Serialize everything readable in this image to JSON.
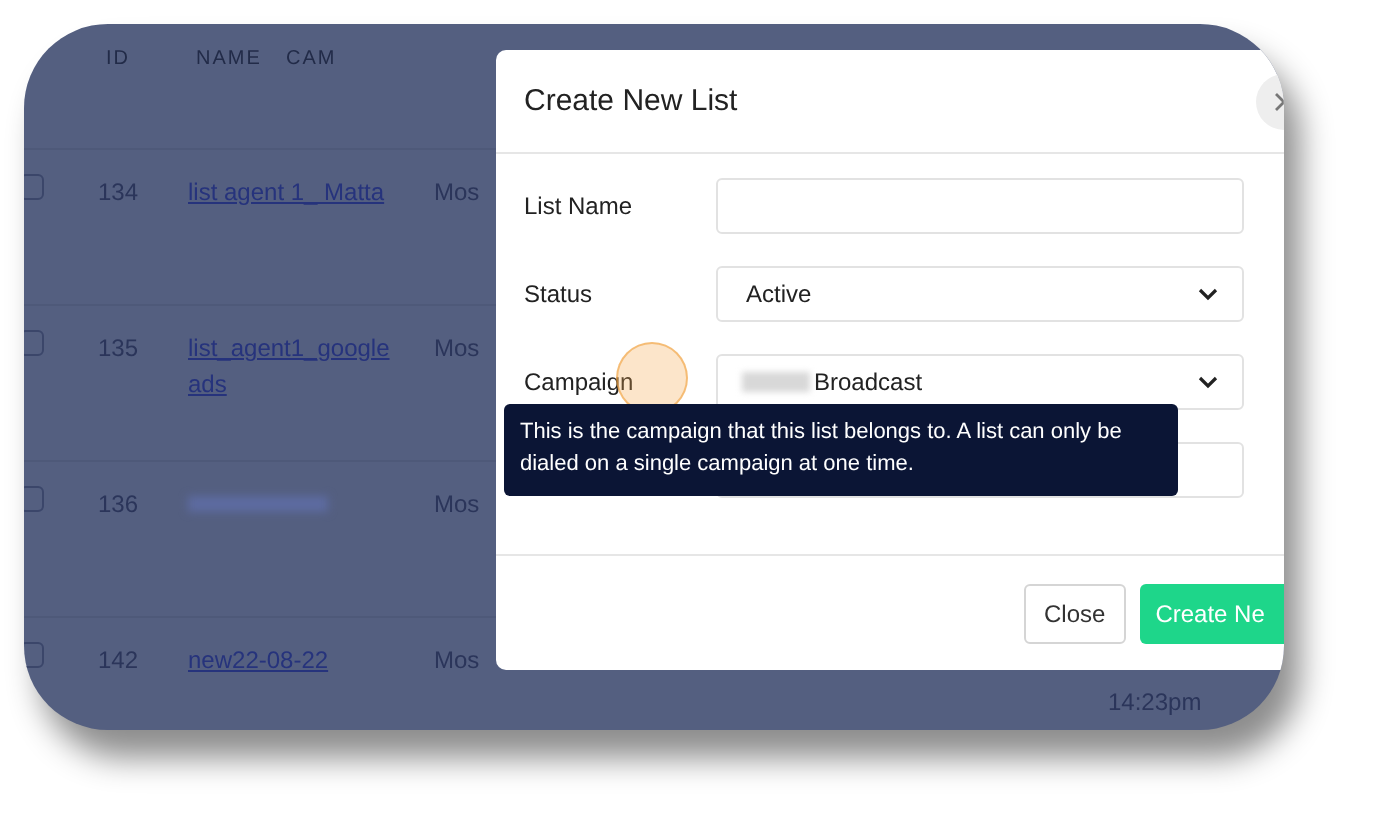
{
  "table": {
    "columns": [
      "ID",
      "NAME",
      "CAM"
    ],
    "rows": [
      {
        "checked": false,
        "id": "134",
        "name": "list agent 1_ Matta",
        "campaign": "Mos",
        "redacted": false
      },
      {
        "checked": false,
        "id": "135",
        "name": "list_agent1_google ads",
        "campaign": "Mos",
        "redacted": false
      },
      {
        "checked": false,
        "id": "136",
        "campaign": "Mos",
        "redacted": true
      },
      {
        "checked": false,
        "id": "142",
        "name": "new22-08-22",
        "campaign": "Mos",
        "redacted": false
      }
    ],
    "trailing_time": "14:23pm"
  },
  "modal": {
    "title": "Create New List",
    "fields": [
      {
        "kind": "input",
        "label": "List Name"
      },
      {
        "kind": "select",
        "label": "Status",
        "value": "Active"
      },
      {
        "kind": "select",
        "label": "Campaign",
        "value": "Broadcast",
        "redacted_prefix": true
      },
      {
        "kind": "input"
      }
    ],
    "tooltip": "This is the campaign that this list belongs to. A list can only be dialed on a single campaign at one time.",
    "buttons": [
      {
        "kind": "secondary",
        "label": "Close"
      },
      {
        "kind": "primary",
        "label": "Create Ne"
      }
    ]
  }
}
